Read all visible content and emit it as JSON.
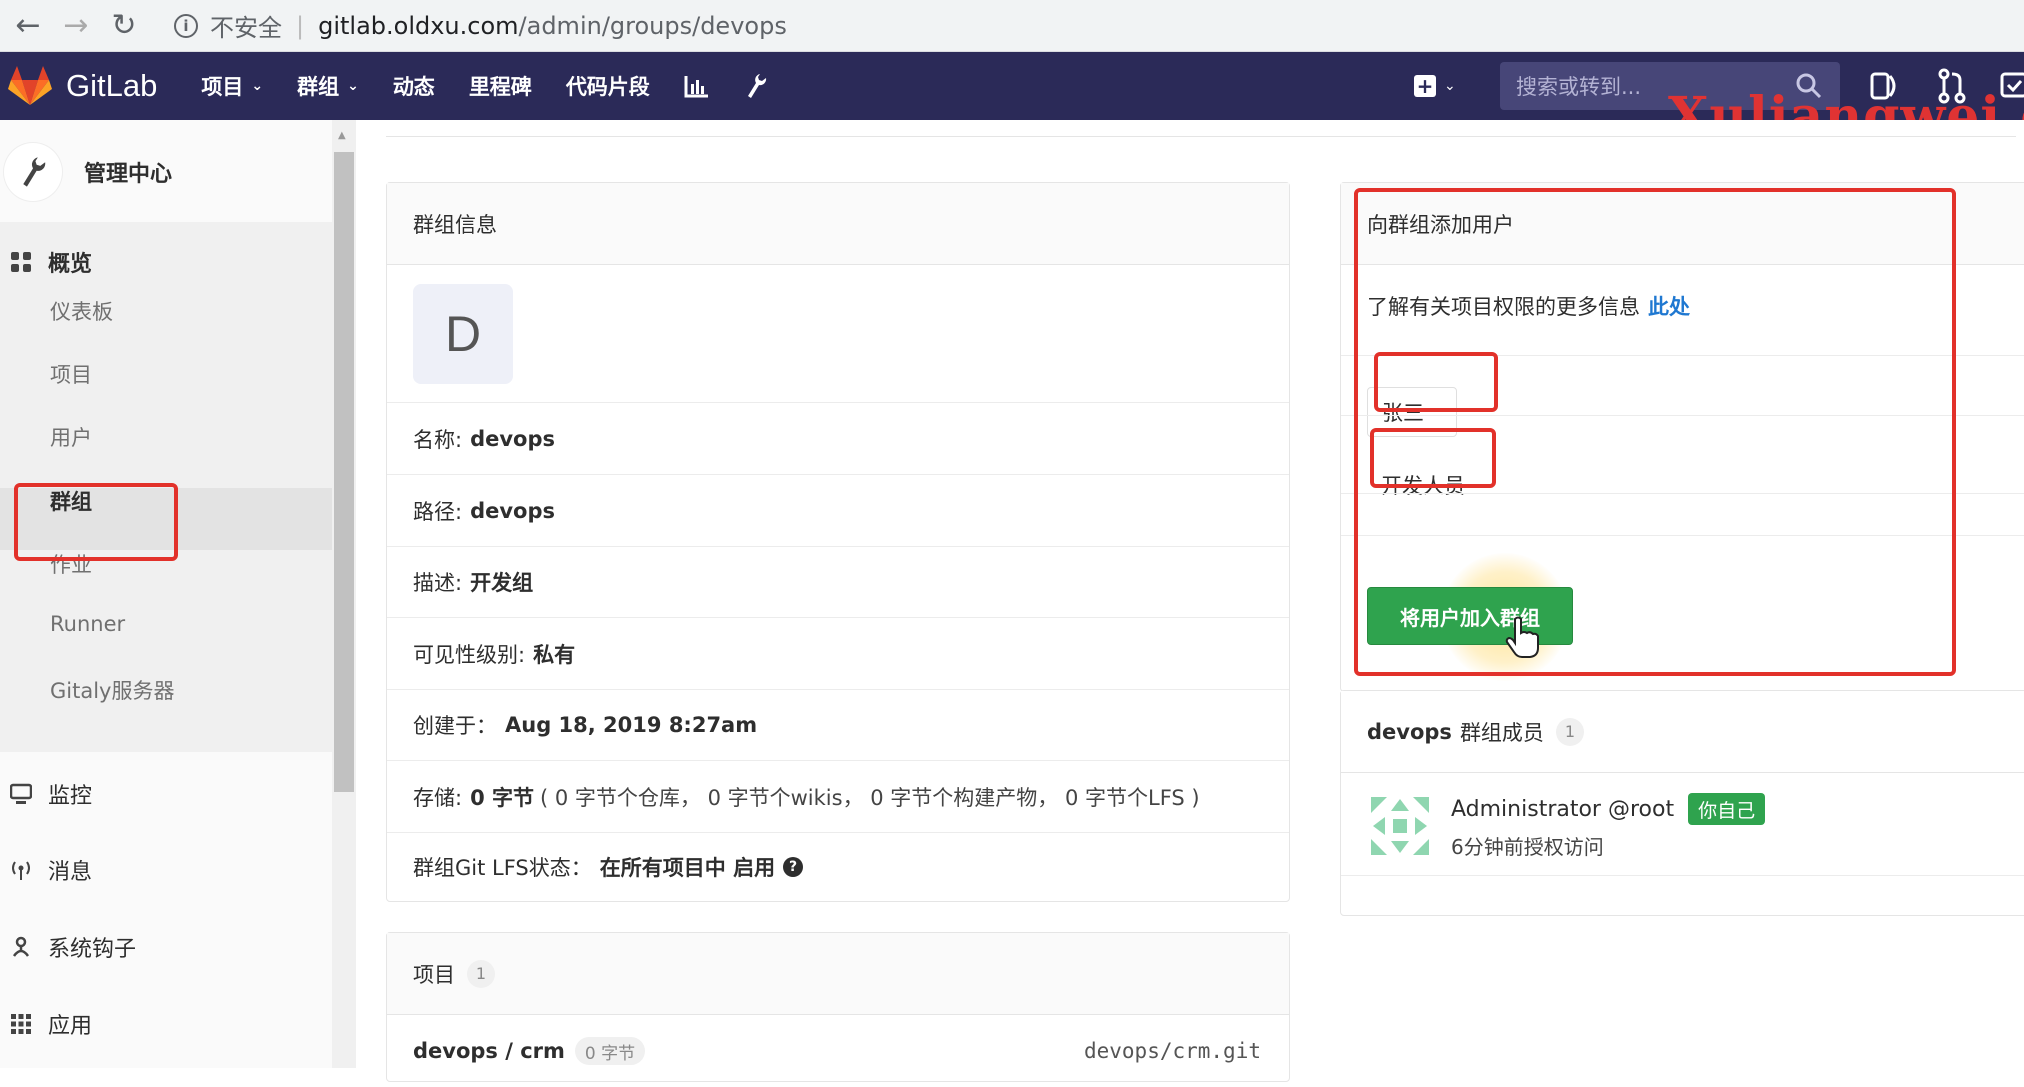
{
  "browser": {
    "insecure_label": "不安全",
    "url_host": "gitlab.oldxu.com",
    "url_path": "/admin/groups/devops"
  },
  "navbar": {
    "brand": "GitLab",
    "items": [
      {
        "label": "项目",
        "dropdown": true
      },
      {
        "label": "群组",
        "dropdown": true
      },
      {
        "label": "动态",
        "dropdown": false
      },
      {
        "label": "里程碑",
        "dropdown": false
      },
      {
        "label": "代码片段",
        "dropdown": false
      }
    ],
    "search_placeholder": "搜索或转到..."
  },
  "watermark": "Xuliangwei.c",
  "sidebar": {
    "title": "管理中心",
    "overview": "概览",
    "overview_items": [
      "仪表板",
      "项目",
      "用户",
      "群组",
      "作业",
      "Runner",
      "Gitaly服务器"
    ],
    "active_item": "群组",
    "sections": [
      "监控",
      "消息",
      "系统钩子",
      "应用"
    ]
  },
  "group_info": {
    "header": "群组信息",
    "avatar_letter": "D",
    "name_label": "名称:",
    "name_value": "devops",
    "path_label": "路径:",
    "path_value": "devops",
    "desc_label": "描述:",
    "desc_value": "开发组",
    "visibility_label": "可见性级别:",
    "visibility_value": "私有",
    "created_label": "创建于：",
    "created_value": "Aug 18, 2019 8:27am",
    "storage_label": "存储:",
    "storage_value": "0 字节",
    "storage_detail": "( 0 字节个仓库， 0 字节个wikis， 0 字节个构建产物， 0 字节个LFS )",
    "lfs_label": "群组Git LFS状态：",
    "lfs_value": "在所有项目中 启用"
  },
  "projects": {
    "header": "项目",
    "count": "1",
    "items": [
      {
        "name": "devops / crm",
        "size": "0 字节",
        "repo": "devops/crm.git"
      }
    ]
  },
  "add_user": {
    "header": "向群组添加用户",
    "help_text": "了解有关项目权限的更多信息",
    "help_link": "此处",
    "user_value": "张三",
    "role_value": "开发人员",
    "submit_label": "将用户加入群组"
  },
  "members": {
    "group_name": "devops",
    "header_suffix": "群组成员",
    "count": "1",
    "items": [
      {
        "name": "Administrator @root",
        "badge": "你自己",
        "access": "6分钟前授权访问"
      }
    ]
  },
  "colors": {
    "navbar": "#2b2a58",
    "highlight_box": "#e2312a",
    "primary_button": "#2fa34e",
    "link": "#1f78d1"
  }
}
